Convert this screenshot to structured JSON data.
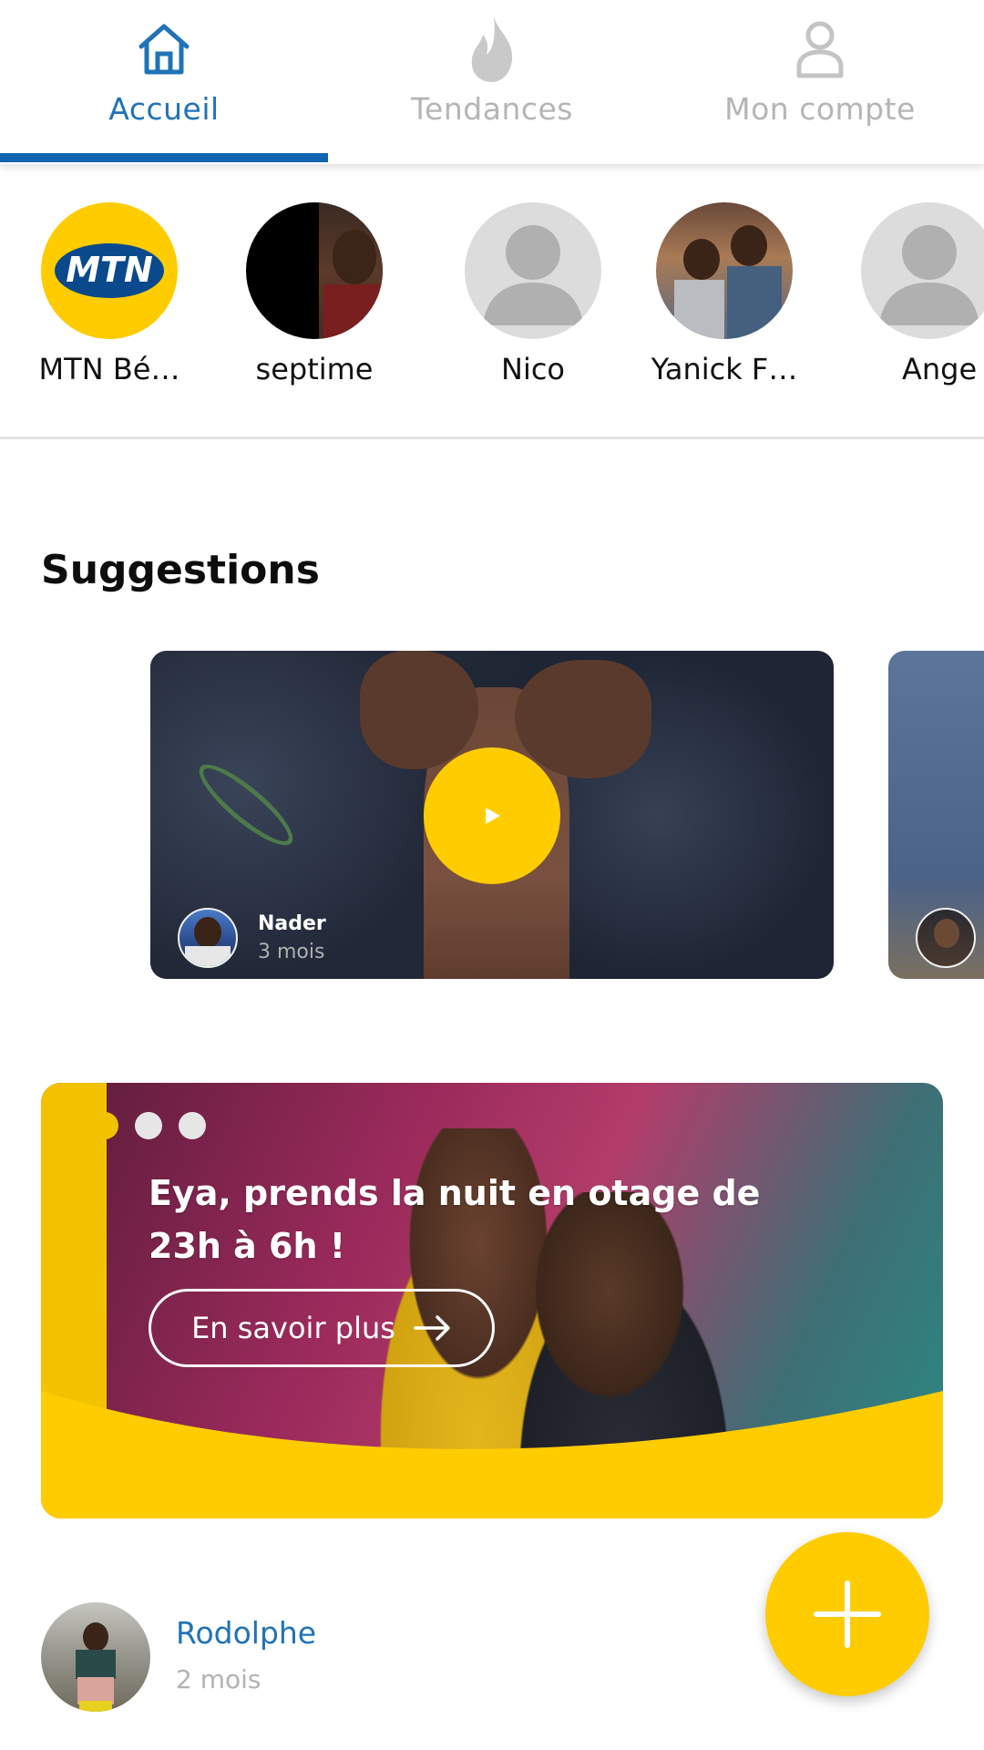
{
  "tabs": [
    {
      "label": "Accueil",
      "icon": "home-icon",
      "active": true
    },
    {
      "label": "Tendances",
      "icon": "flame-icon",
      "active": false
    },
    {
      "label": "Mon compte",
      "icon": "user-icon",
      "active": false
    }
  ],
  "stories": [
    {
      "label": "MTN Bé…",
      "avatar": "mtn-logo"
    },
    {
      "label": "septime",
      "avatar": "photo"
    },
    {
      "label": "Nico",
      "avatar": "placeholder"
    },
    {
      "label": "Yanick F…",
      "avatar": "photo"
    },
    {
      "label": "Ange",
      "avatar": "placeholder"
    }
  ],
  "mtn_logo_text": "MTN",
  "suggestions": {
    "title": "Suggestions",
    "videos": [
      {
        "author": "Nader",
        "time": "3 mois"
      }
    ]
  },
  "banner": {
    "headline_line1": "Eya, prends la nuit en otage de",
    "headline_line2": "23h à 6h !",
    "cta_label": "En savoir plus",
    "slide_count": 3,
    "active_slide": 1
  },
  "post": {
    "author": "Rodolphe",
    "time": "2 mois"
  },
  "colors": {
    "brand_yellow": "#ffcc00",
    "accent_blue": "#1f73b7",
    "inactive_gray": "#b5b5b5"
  }
}
